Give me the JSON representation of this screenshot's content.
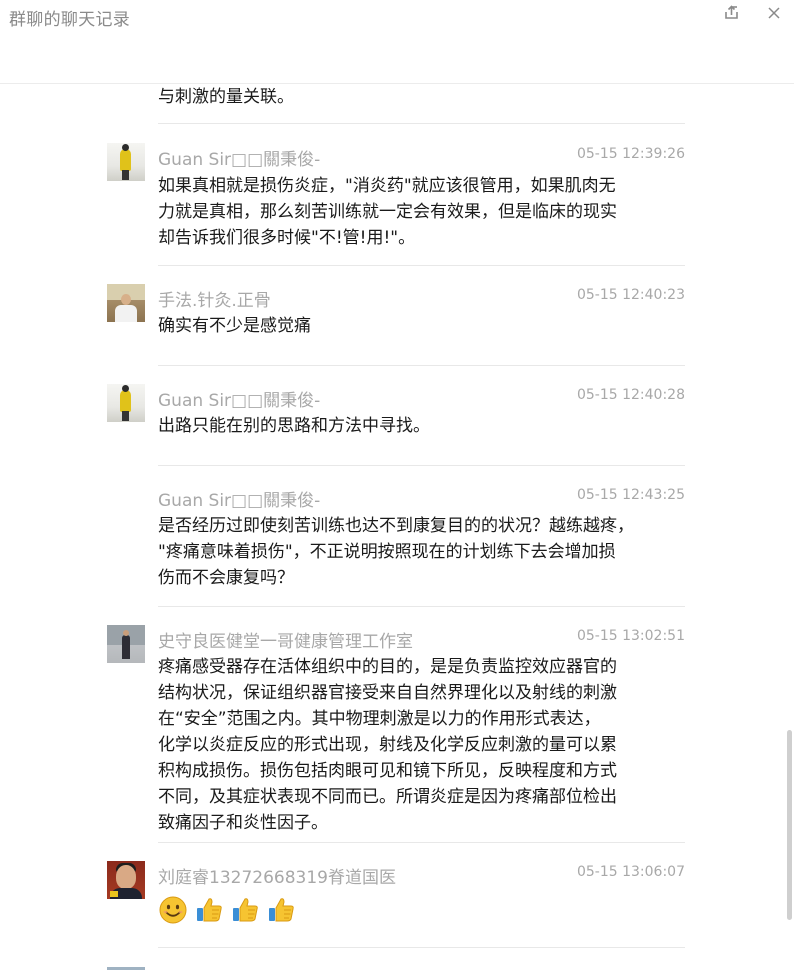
{
  "window": {
    "title": "群聊的聊天记录",
    "share_icon": "share-icon",
    "close_icon": "close-icon"
  },
  "partial_previous_line": "与刺激的量关联。",
  "messages": [
    {
      "sender": "Guan Sir□□關秉俊-",
      "time": "05-15 12:39:26",
      "avatar": "guan",
      "lines": [
        "如果真相就是损伤炎症，\"消炎药\"就应该很管用，如果肌肉无",
        "力就是真相，那么刻苦训练就一定会有效果，但是临床的现实",
        "却告诉我们很多时候\"不!管!用!\"。"
      ]
    },
    {
      "sender": "手法.针灸.正骨",
      "time": "05-15 12:40:23",
      "avatar": "shou",
      "lines": [
        "确实有不少是感觉痛"
      ]
    },
    {
      "sender": "Guan Sir□□關秉俊-",
      "time": "05-15 12:40:28",
      "avatar": "guan",
      "lines": [
        "出路只能在别的思路和方法中寻找。"
      ]
    },
    {
      "sender": "Guan Sir□□關秉俊-",
      "time": "05-15 12:43:25",
      "avatar": "",
      "lines": [
        "是否经历过即使刻苦训练也达不到康复目的的状况？越练越疼，",
        "\"疼痛意味着损伤\"，不正说明按照现在的计划练下去会增加损",
        "伤而不会康复吗？"
      ]
    },
    {
      "sender": "史守良医健堂一哥健康管理工作室",
      "time": "05-15 13:02:51",
      "avatar": "shi",
      "lines": [
        "疼痛感受器存在活体组织中的目的，是是负责监控效应器官的",
        "结构状况，保证组织器官接受来自自然界理化以及射线的刺激",
        "在“安全”范围之内。其中物理刺激是以力的作用形式表达，",
        "化学以炎症反应的形式出现，射线及化学反应刺激的量可以累",
        "积构成损伤。损伤包括肉眼可见和镜下所见，反映程度和方式",
        "不同，及其症状表现不同而已。所谓炎症是因为疼痛部位检出",
        "致痛因子和炎性因子。"
      ]
    },
    {
      "sender": "刘庭睿13272668319脊道国医",
      "time": "05-15 13:06:07",
      "avatar": "liu",
      "emojis": [
        "smile-emoji",
        "thumbs-up-emoji",
        "thumbs-up-emoji",
        "thumbs-up-emoji"
      ]
    }
  ],
  "colors": {
    "meta_text": "#a8a8a8",
    "body_text": "#1a1a1a",
    "divider": "#e8e8e8",
    "scrollbar_thumb": "#cfcfcf"
  }
}
